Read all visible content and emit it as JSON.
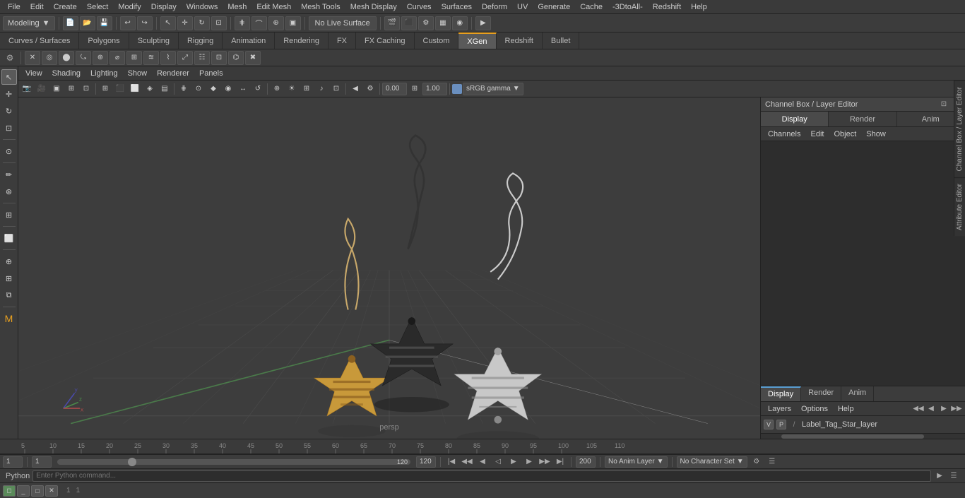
{
  "app": {
    "title": "Maya"
  },
  "menu": {
    "items": [
      "File",
      "Edit",
      "Create",
      "Select",
      "Modify",
      "Display",
      "Windows",
      "Mesh",
      "Edit Mesh",
      "Mesh Tools",
      "Mesh Display",
      "Curves",
      "Surfaces",
      "Deform",
      "UV",
      "Generate",
      "Cache",
      "-3DtoAll-",
      "Redshift",
      "Help"
    ]
  },
  "toolbar1": {
    "workspace_label": "Modeling",
    "live_surface": "No Live Surface"
  },
  "workspace_tabs": {
    "items": [
      {
        "label": "Curves / Surfaces",
        "active": false
      },
      {
        "label": "Polygons",
        "active": false
      },
      {
        "label": "Sculpting",
        "active": false
      },
      {
        "label": "Rigging",
        "active": false
      },
      {
        "label": "Animation",
        "active": false
      },
      {
        "label": "Rendering",
        "active": false
      },
      {
        "label": "FX",
        "active": false
      },
      {
        "label": "FX Caching",
        "active": false
      },
      {
        "label": "Custom",
        "active": false
      },
      {
        "label": "XGen",
        "active": true
      },
      {
        "label": "Redshift",
        "active": false
      },
      {
        "label": "Bullet",
        "active": false
      }
    ]
  },
  "viewport_menu": {
    "items": [
      "View",
      "Shading",
      "Lighting",
      "Show",
      "Renderer",
      "Panels"
    ]
  },
  "viewport_toolbar": {
    "coord": "0.00",
    "scale": "1.00",
    "color_space": "sRGB gamma"
  },
  "viewport3d": {
    "label": "persp"
  },
  "right_panel": {
    "title": "Channel Box / Layer Editor",
    "tabs": [
      {
        "label": "Display",
        "active": true
      },
      {
        "label": "Render",
        "active": false
      },
      {
        "label": "Anim",
        "active": false
      }
    ],
    "menu": [
      "Channels",
      "Edit",
      "Object",
      "Show"
    ],
    "layer_tabs": [
      {
        "label": "Display",
        "active": true
      },
      {
        "label": "Render",
        "active": false
      },
      {
        "label": "Anim",
        "active": false
      }
    ],
    "layer_options": [
      "Layers",
      "Options",
      "Help"
    ],
    "layers": [
      {
        "v": "V",
        "p": "P",
        "name": "Label_Tag_Star_layer"
      }
    ]
  },
  "right_edge": {
    "tabs": [
      "Channel Box / Layer Editor",
      "Attribute Editor"
    ]
  },
  "timeline": {
    "start": 1,
    "end": 120,
    "current": 1,
    "ticks": [
      "5",
      "10",
      "15",
      "20",
      "25",
      "30",
      "35",
      "40",
      "45",
      "50",
      "55",
      "60",
      "65",
      "70",
      "75",
      "80",
      "85",
      "90",
      "95",
      "100",
      "105",
      "110"
    ]
  },
  "status_bar": {
    "current_frame": "1",
    "range_start": "1",
    "range_slider_val": "120",
    "range_end": "120",
    "playback_end": "200",
    "anim_layer": "No Anim Layer",
    "character_set": "No Character Set"
  },
  "python_bar": {
    "label": "Python"
  },
  "bottom_row": {
    "window_label": "1",
    "frame1": "1",
    "frame2": "1"
  }
}
